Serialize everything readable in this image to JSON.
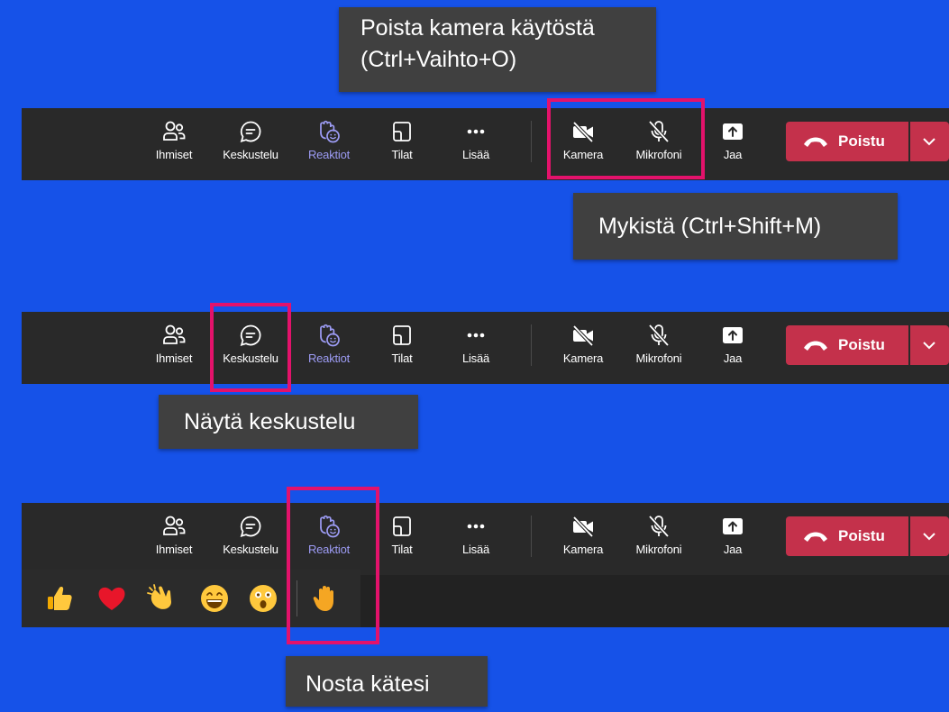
{
  "colors": {
    "background": "#1652e8",
    "toolbar": "#292929",
    "tooltip": "#404040",
    "highlight": "#e3126b",
    "leave": "#c4314b",
    "accent": "#9d9cf5"
  },
  "tooltips": {
    "camera_line1": "Poista kamera käytöstä",
    "camera_line2": "(Ctrl+Vaihto+O)",
    "mute": "Mykistä (Ctrl+Shift+M)",
    "chat": "Näytä keskustelu",
    "raise_hand": "Nosta kätesi"
  },
  "toolbar": {
    "people": "Ihmiset",
    "chat": "Keskustelu",
    "reactions": "Reaktiot",
    "rooms": "Tilat",
    "more": "Lisää",
    "camera": "Kamera",
    "mic": "Mikrofoni",
    "share": "Jaa",
    "leave": "Poistu",
    "icons": [
      "people-icon",
      "chat-icon",
      "reactions-icon",
      "rooms-icon",
      "more-icon",
      "camera-off-icon",
      "mic-off-icon",
      "share-icon",
      "phone-hangup-icon",
      "chevron-down-icon"
    ]
  },
  "reactions_tray": {
    "icons": [
      "thumbs-up-icon",
      "heart-icon",
      "clapping-hands-icon",
      "laughing-face-icon",
      "surprised-face-icon",
      "raised-hand-icon"
    ]
  }
}
